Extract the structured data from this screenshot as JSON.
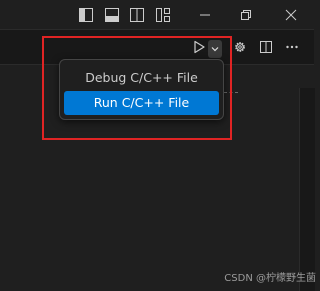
{
  "title_bar": {
    "layout_buttons": [
      "toggle-primary-sidebar-icon",
      "toggle-panel-icon",
      "toggle-secondary-sidebar-icon",
      "customize-layout-icon"
    ],
    "window_buttons": [
      "minimize-icon",
      "restore-icon",
      "close-icon"
    ]
  },
  "editor_toolbar": {
    "icons": [
      "run-play-icon",
      "chevron-down-icon",
      "gear-icon",
      "split-editor-icon",
      "more-actions-icon"
    ]
  },
  "run_menu": {
    "items": [
      {
        "label": "Debug C/C++ File",
        "selected": false
      },
      {
        "label": "Run C/C++ File",
        "selected": true
      }
    ]
  },
  "watermark": {
    "text": "CSDN @柠檬野生菌"
  },
  "colors": {
    "background": "#1f1f1f",
    "selection": "#0078d4",
    "annotation_border": "#e02424"
  }
}
